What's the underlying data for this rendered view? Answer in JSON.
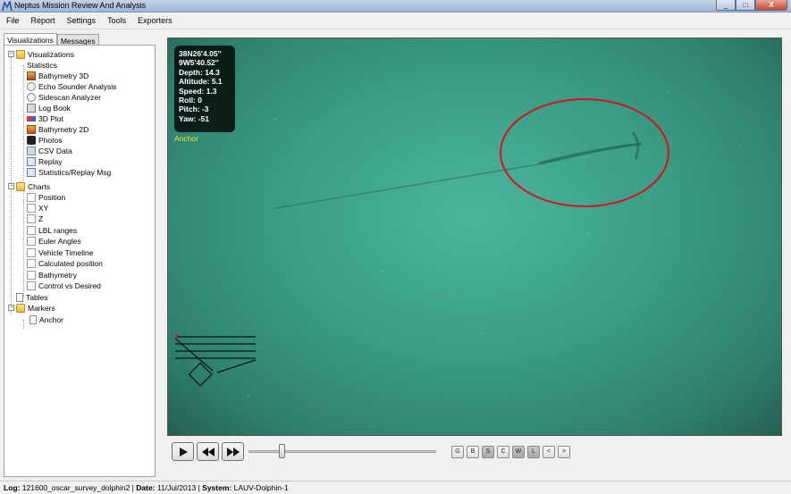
{
  "window": {
    "title": "Neptus Mission Review And Analysis",
    "buttons": [
      "_",
      "□",
      "X"
    ]
  },
  "menu": [
    "File",
    "Report",
    "Settings",
    "Tools",
    "Exporters"
  ],
  "tabs": [
    "Visualizations",
    "Messages"
  ],
  "tree": {
    "visualizations": {
      "label": "Visualizations",
      "items": [
        "Statistics",
        "Bathymetry 3D",
        "Echo Sounder Analysis",
        "Sidescan Analyzer",
        "Log Book",
        "3D Plot",
        "Bathymetry 2D",
        "Photos",
        "CSV Data",
        "Replay",
        "Statistics/Replay Msg"
      ]
    },
    "charts": {
      "label": "Charts",
      "items": [
        "Position",
        "XY",
        "Z",
        "LBL ranges",
        "Euler Angles",
        "Vehicle Timeline",
        "Calculated position",
        "Bathymetry",
        "Control vs Desired"
      ]
    },
    "tables": {
      "label": "Tables"
    },
    "markers": {
      "label": "Markers",
      "items": [
        "Anchor"
      ]
    }
  },
  "viewer": {
    "info": [
      "38N26'4.05''",
      "9W5'40.52''",
      "Depth: 14.3",
      "Altitude: 5.1",
      "Speed: 1.3",
      "Roll: 0",
      "Pitch: -3",
      "Yaw: -51"
    ],
    "marker": "Anchor",
    "annotation_color": "#d9101f",
    "marker_color": "#e6e62a"
  },
  "controls": {
    "play_icon": "play-icon",
    "rewind_icon": "rewind-icon",
    "forward_icon": "fast-forward-icon",
    "position": 0.16,
    "toggles": [
      "G",
      "B",
      "S",
      "C",
      "W",
      "L",
      "<",
      ">"
    ]
  },
  "status": {
    "log_label": "Log:",
    "log": "121600_oscar_survey_dolphin2",
    "date_label": "Date:",
    "date": "11/Jul/2013",
    "system_label": "System:",
    "system": "LAUV-Dolphin-1"
  }
}
